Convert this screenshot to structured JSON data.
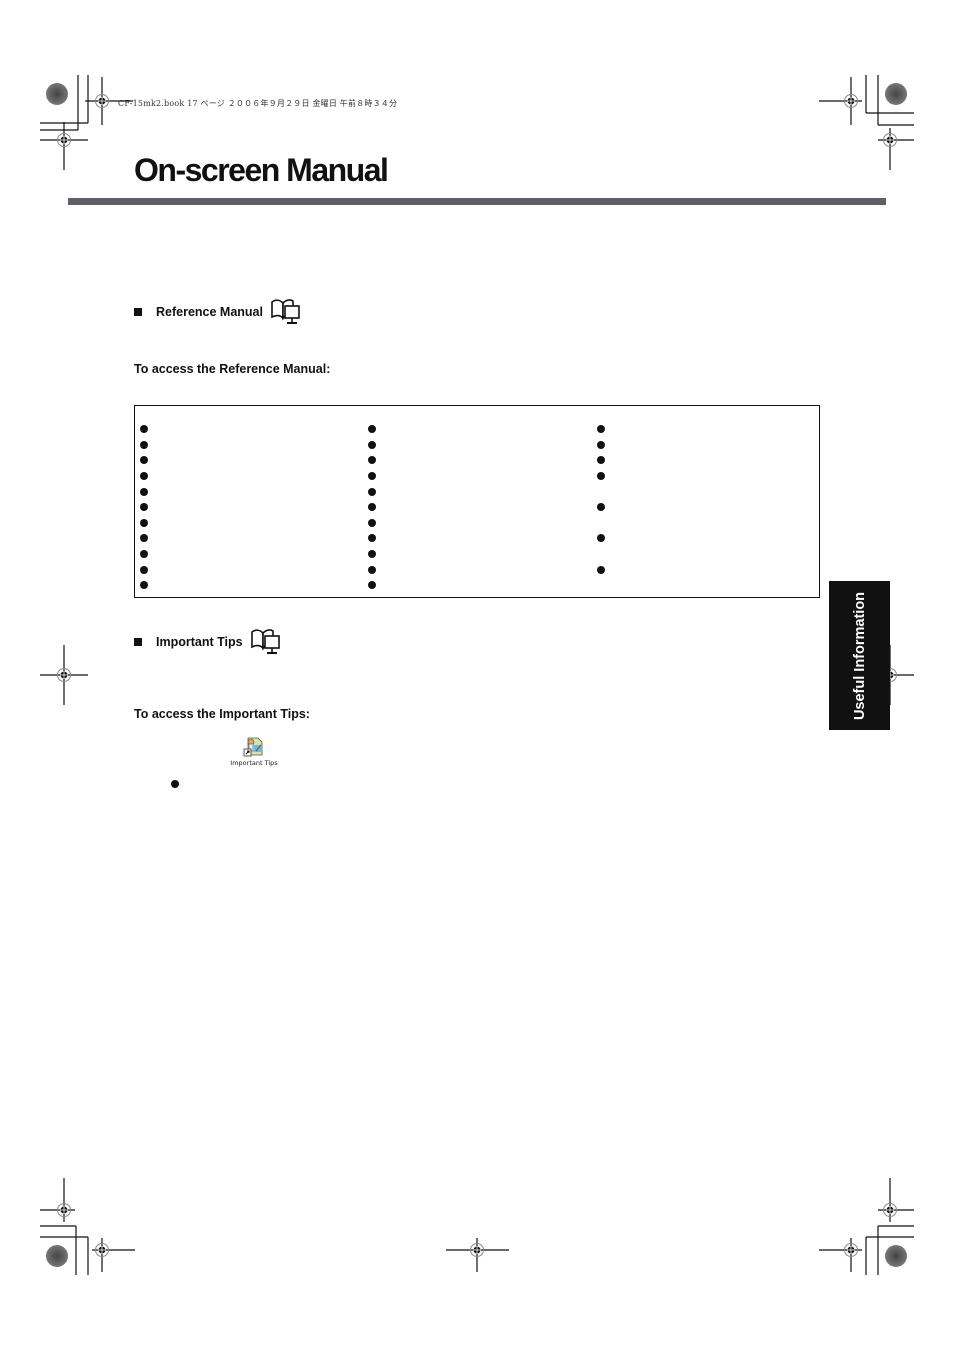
{
  "header_meta": "CF-15mk2.book  17 ページ  ２００６年９月２９日  金曜日  午前８時３４分",
  "page_title": "On-screen Manual",
  "sections": {
    "reference_manual": {
      "heading": "Reference Manual",
      "icon": "book-monitor-icon",
      "access_heading": "To access the Reference Manual:",
      "bullet_columns": [
        {
          "bullet_count": 11
        },
        {
          "bullet_count": 11
        },
        {
          "bullet_count": 7
        }
      ]
    },
    "important_tips": {
      "heading": "Important Tips",
      "icon": "book-monitor-icon",
      "access_heading": "To access the Important Tips:",
      "desktop_icon_label": "Important Tips",
      "bullet_count": 1
    }
  },
  "side_tab": {
    "label": "Useful Information",
    "background": "#111111",
    "text_color": "#ffffff"
  },
  "colors": {
    "title_rule": "#5f6067",
    "text": "#111111"
  }
}
